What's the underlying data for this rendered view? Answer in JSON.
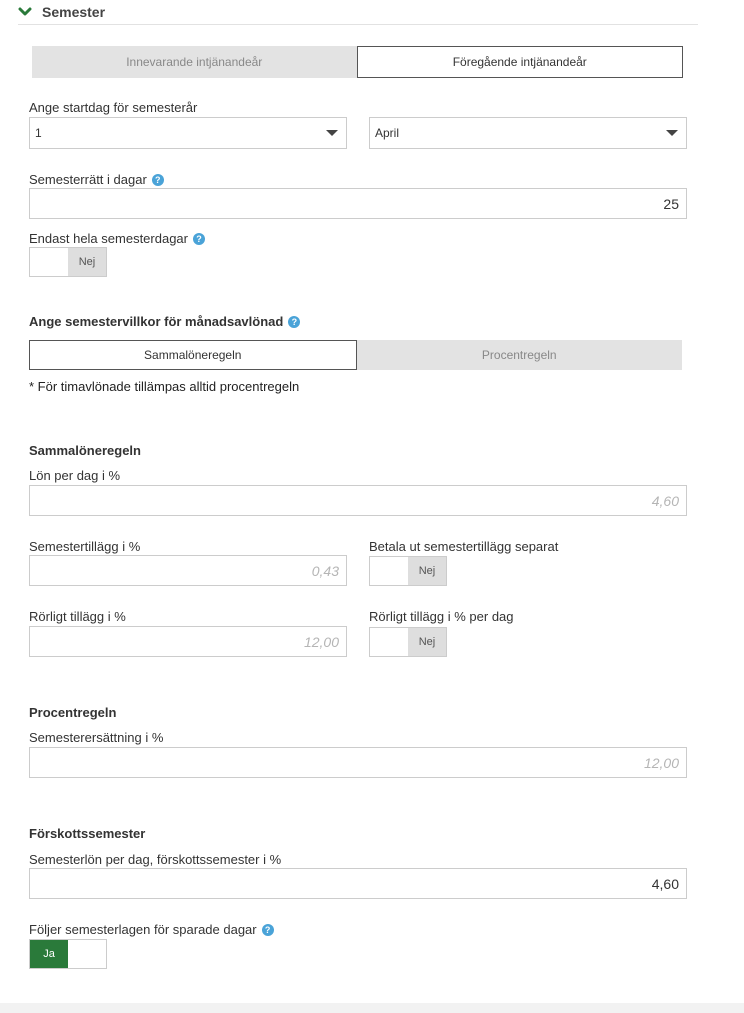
{
  "section": {
    "title": "Semester"
  },
  "period_tabs": [
    {
      "label": "Innevarande intjänandeår",
      "active": false
    },
    {
      "label": "Föregående intjänandeår",
      "active": true
    }
  ],
  "start_day": {
    "label": "Ange startdag för semesterår",
    "day_value": "1",
    "month_value": "April"
  },
  "vacation_days": {
    "label": "Semesterrätt i dagar",
    "value": "25"
  },
  "whole_days": {
    "label": "Endast hela semesterdagar",
    "toggle": "Nej"
  },
  "monthly_terms": {
    "label": "Ange semestervillkor för månadsavlönad",
    "tabs": [
      {
        "label": "Sammalöneregeln",
        "active": true
      },
      {
        "label": "Procentregeln",
        "active": false
      }
    ],
    "note": "* För timavlönade tillämpas alltid procentregeln"
  },
  "sammaloneregeln": {
    "heading": "Sammalöneregeln",
    "pay_per_day": {
      "label": "Lön per dag i %",
      "placeholder": "4,60"
    },
    "supplement": {
      "label": "Semestertillägg i %",
      "placeholder": "0,43"
    },
    "pay_separately": {
      "label": "Betala ut semestertillägg separat",
      "toggle": "Nej"
    },
    "variable": {
      "label": "Rörligt tillägg i %",
      "placeholder": "12,00"
    },
    "variable_per_day": {
      "label": "Rörligt tillägg i % per dag",
      "toggle": "Nej"
    }
  },
  "procentregeln": {
    "heading": "Procentregeln",
    "compensation": {
      "label": "Semesterersättning i %",
      "placeholder": "12,00"
    }
  },
  "forskott": {
    "heading": "Förskottssemester",
    "pay_per_day": {
      "label": "Semesterlön per dag, förskottssemester i %",
      "value": "4,60"
    }
  },
  "saved_days": {
    "label": "Följer semesterlagen för sparade dagar",
    "toggle": "Ja"
  },
  "icons": {
    "chevron": "chevron-down-icon",
    "help": "help-circle-icon"
  },
  "colors": {
    "accent": "#2a7a3a",
    "help": "#4aa3d8",
    "inactive_tab": "#e3e3e3"
  }
}
